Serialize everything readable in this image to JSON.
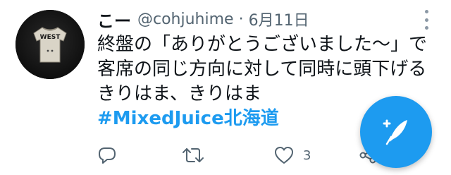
{
  "tweet": {
    "author_display_name": "こー",
    "author_handle": "@cohjuhime",
    "separator": "·",
    "date": "6月11日",
    "text_lines": [
      "終盤の「ありがとうございました〜」で",
      "客席の同じ方向に対して同時に頭下げる",
      "きりはま、きりはま"
    ],
    "hashtag": "#MixedJuice北海道",
    "avatar_shirt_text": "WEST",
    "like_count": "3"
  },
  "icons": {
    "reply": "reply-icon",
    "retweet": "retweet-icon",
    "like": "heart-icon",
    "share": "share-icon",
    "more": "more-vertical-icon",
    "compose": "compose-tweet-icon"
  },
  "colors": {
    "accent": "#1d9bf0",
    "text_primary": "#0f1419",
    "text_secondary": "#536471"
  }
}
